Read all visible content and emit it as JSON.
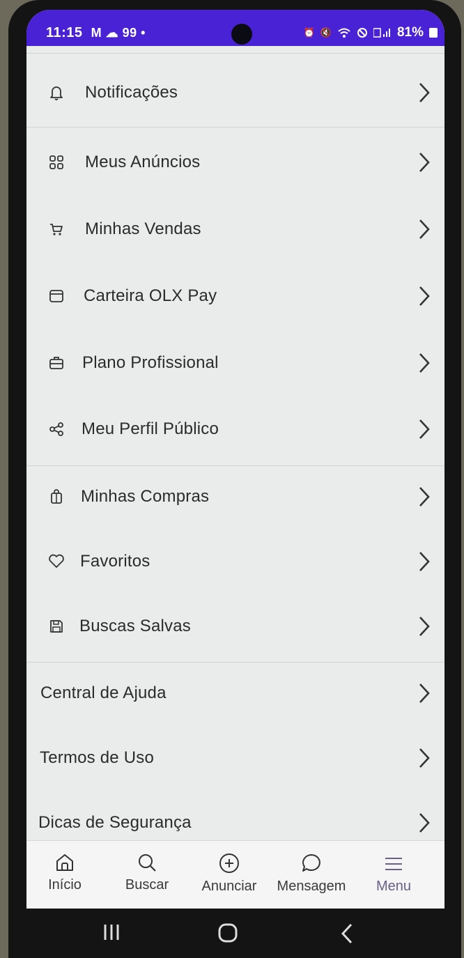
{
  "status_bar": {
    "time": "11:15",
    "indicators": "M ☁ 99 •",
    "battery": "81%",
    "bg_color": "#4a22d6"
  },
  "menu": {
    "items": [
      {
        "label": "Notificações",
        "icon": "bell-icon"
      },
      {
        "label": "Meus Anúncios",
        "icon": "grid-icon"
      },
      {
        "label": "Minhas Vendas",
        "icon": "cart-icon"
      },
      {
        "label": "Carteira OLX Pay",
        "icon": "wallet-icon"
      },
      {
        "label": "Plano Profissional",
        "icon": "briefcase-icon"
      },
      {
        "label": "Meu Perfil Público",
        "icon": "share-icon"
      },
      {
        "label": "Minhas Compras",
        "icon": "shopping-bag-icon"
      },
      {
        "label": "Favoritos",
        "icon": "heart-icon"
      },
      {
        "label": "Buscas Salvas",
        "icon": "save-icon"
      },
      {
        "label": "Central de Ajuda"
      },
      {
        "label": "Termos de Uso"
      },
      {
        "label": "Dicas de Segurança"
      }
    ]
  },
  "bottom_nav": {
    "items": [
      {
        "label": "Início",
        "icon": "home-icon"
      },
      {
        "label": "Buscar",
        "icon": "search-icon"
      },
      {
        "label": "Anunciar",
        "icon": "plus-circle-icon"
      },
      {
        "label": "Mensagem",
        "icon": "chat-icon"
      },
      {
        "label": "Menu",
        "icon": "hamburger-icon"
      }
    ],
    "active": "Menu"
  }
}
